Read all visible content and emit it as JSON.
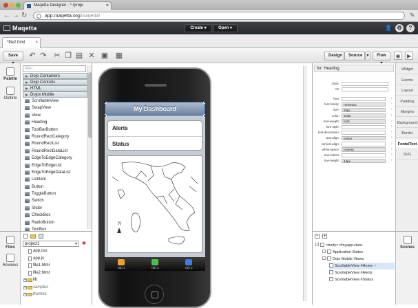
{
  "browser": {
    "tab_title": "Maqetta Designer - *./proje",
    "url_host": "app.maqetta.org",
    "url_path": "/maqetta/"
  },
  "app": {
    "logo": "Maqetta",
    "create_label": "Create",
    "open_label": "Open"
  },
  "editor": {
    "file_tab": "*file2.html"
  },
  "toolbar": {
    "save_label": "Save",
    "design_label": "Design",
    "source_label": "Source",
    "flow_label": "Flow"
  },
  "left_strip": {
    "palette_label": "Palette",
    "outline_label": "Outline"
  },
  "palette": {
    "filter_placeholder": "filter",
    "categories": [
      "Dojo Containers",
      "Dojo Controls",
      "HTML",
      "Dojox Mobile"
    ],
    "items": [
      "ScrollableView",
      "SwapView",
      "View",
      "Heading",
      "ToolBarButton",
      "RoundRectCategory",
      "RoundRectList",
      "RoundRectDataList",
      "EdgeToEdgeCategory",
      "EdgeToEdgeList",
      "EdgeToEdgeDataList",
      "ListItem",
      "Button",
      "ToggleButton",
      "Switch",
      "Slider",
      "CheckBox",
      "RadioButton",
      "TextBox"
    ]
  },
  "phone": {
    "heading": "My Dashboard",
    "rows": [
      "Alerts",
      "Status"
    ],
    "tabs": [
      "Tab 1",
      "Tab 2",
      "Tab 3"
    ],
    "map_north": "N"
  },
  "properties": {
    "for_label": "for:",
    "for_value": "Heading",
    "class_label": "class:",
    "id_label": "ID:",
    "rows": [
      {
        "label": "font:",
        "value": ""
      },
      {
        "label": "font-family:",
        "value": "Helvetica"
      },
      {
        "label": "size:",
        "value": "20px"
      },
      {
        "label": "color:",
        "value": "white"
      },
      {
        "label": "font-weight:",
        "value": "bold"
      },
      {
        "label": "font-style:",
        "value": ""
      },
      {
        "label": "text-decoration:",
        "value": ""
      },
      {
        "label": "text-align:",
        "value": "center"
      },
      {
        "label": "vertical-align:",
        "value": ""
      },
      {
        "label": "white-space:",
        "value": "nowrap"
      },
      {
        "label": "text-indent:",
        "value": ""
      },
      {
        "label": "line-height:",
        "value": "44px"
      }
    ]
  },
  "category_tabs": [
    "Widget",
    "Events",
    "Layout",
    "Padding",
    "Margins",
    "Background",
    "Border",
    "Fonts/Text",
    "SVG"
  ],
  "files_strip": {
    "files_label": "Files",
    "reviews_label": "Reviews"
  },
  "files": {
    "project": "project1",
    "rows": [
      {
        "name": "app.css",
        "kind": "file"
      },
      {
        "name": "app.js",
        "kind": "file"
      },
      {
        "name": "file1.html",
        "kind": "file"
      },
      {
        "name": "file2.html",
        "kind": "file"
      },
      {
        "name": "lib",
        "kind": "folder"
      },
      {
        "name": "samples",
        "kind": "folder-italic"
      },
      {
        "name": "themes",
        "kind": "folder-italic"
      }
    ]
  },
  "outline": {
    "rows": [
      {
        "label": "<body> #myapp.claro",
        "indent": 0
      },
      {
        "label": "Application States",
        "indent": 1
      },
      {
        "label": "Dojo Mobile Views",
        "indent": 1
      },
      {
        "label": "ScrollableView #Home",
        "indent": 2,
        "selected": true
      },
      {
        "label": "ScrollableView #Alerts",
        "indent": 2
      },
      {
        "label": "ScrollableView #Status",
        "indent": 2
      }
    ]
  },
  "scenes_label": "Scenes",
  "colors": {
    "app_bar": "#2f3236",
    "selection": "#2d5aa0",
    "phone_header": "#6d84a2",
    "tab1": "#f0a030",
    "tab2": "#4cc04c",
    "tab3": "#3a7ee0"
  }
}
